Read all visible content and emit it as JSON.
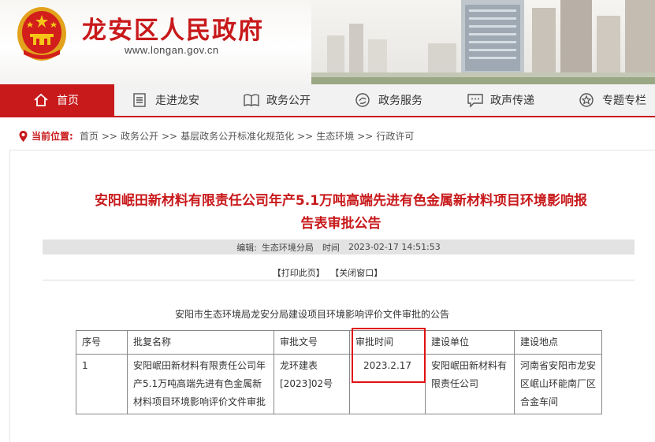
{
  "site": {
    "title": "龙安区人民政府",
    "url": "www.longan.gov.cn"
  },
  "nav": [
    {
      "label": "首页",
      "icon": "home-icon"
    },
    {
      "label": "走进龙安",
      "icon": "list-icon"
    },
    {
      "label": "政务公开",
      "icon": "book-icon"
    },
    {
      "label": "政务服务",
      "icon": "service-icon"
    },
    {
      "label": "政声传递",
      "icon": "chat-icon"
    },
    {
      "label": "专题专栏",
      "icon": "badge-icon"
    }
  ],
  "breadcrumb": {
    "prefix": "当前位置:",
    "items": [
      "首页",
      "政务公开",
      "基层政务公开标准化规范化",
      "生态环境",
      "行政许可"
    ],
    "separator": ">>"
  },
  "article": {
    "title_line1": "安阳岷田新材料有限责任公司年产5.1万吨高端先进有色金属新材料项目环境影响报",
    "title_line2": "告表审批公告",
    "editor_label": "编辑:",
    "editor": "生态环境分局",
    "time_label": "时间",
    "time": "2023-02-17 14:51:53",
    "print": "【打印此页】",
    "close": "【关闭窗口】",
    "notice": "安阳市生态环境局龙安分局建设项目环境影响评价文件审批的公告"
  },
  "table": {
    "headers": [
      "序号",
      "批复名称",
      "审批文号",
      "审批时间",
      "建设单位",
      "建设地点"
    ],
    "rows": [
      {
        "no": "1",
        "name": "安阳岷田新材料有限责任公司年产5.1万吨高端先进有色金属新材料项目环境影响评价文件审批",
        "doc": "龙环建表[2023]02号",
        "date": "2023.2.17",
        "unit": "安阳岷田新材料有限责任公司",
        "place": "河南省安阳市龙安区岷山环能南厂区合金车间"
      }
    ]
  },
  "colors": {
    "brand_red": "#c8191b",
    "highlight_box": "#e01010"
  }
}
